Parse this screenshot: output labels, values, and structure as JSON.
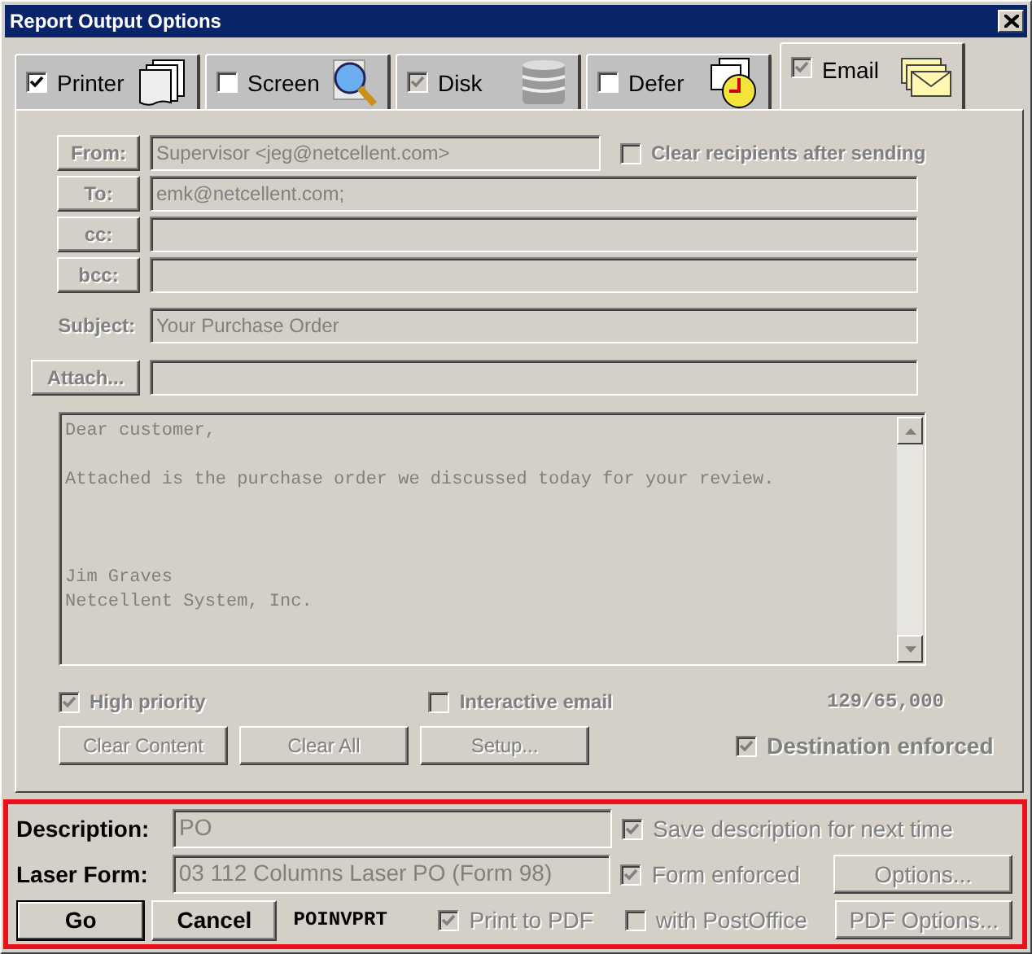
{
  "window": {
    "title": "Report Output Options"
  },
  "tabs": [
    {
      "label": "Printer",
      "kind": "printer",
      "checked": true,
      "disabled": false,
      "selected": false
    },
    {
      "label": "Screen",
      "kind": "screen",
      "checked": false,
      "disabled": false,
      "selected": false
    },
    {
      "label": "Disk",
      "kind": "disk",
      "checked": true,
      "disabled": true,
      "selected": false
    },
    {
      "label": "Defer",
      "kind": "defer",
      "checked": false,
      "disabled": false,
      "selected": false
    },
    {
      "label": "Email",
      "kind": "email",
      "checked": true,
      "disabled": true,
      "selected": true
    }
  ],
  "email": {
    "disabled": true,
    "recipients": [
      {
        "button": "From:",
        "value": "Supervisor <jeg@netcellent.com>"
      },
      {
        "button": "To:",
        "value": "emk@netcellent.com;"
      },
      {
        "button": "cc:"
      },
      {
        "button": "bcc:"
      }
    ],
    "clear_recipients": {
      "label": "Clear recipients after sending",
      "checked": false
    },
    "subject": {
      "label": "Subject:",
      "value": "Your Purchase Order"
    },
    "attach": {
      "button": "Attach..."
    },
    "message": "Dear customer,\n\nAttached is the purchase order we discussed today for your review.\n\n\n\nJim Graves\nNetcellent System, Inc.",
    "options": [
      {
        "label": "High priority",
        "checked": true
      },
      {
        "label": "Interactive email",
        "checked": false
      }
    ],
    "counter": "129/65,000",
    "buttons": [
      "Clear Content",
      "Clear All",
      "Setup..."
    ],
    "destination_enforced": {
      "label": "Destination enforced",
      "checked": true
    }
  },
  "footer": {
    "description": {
      "label": "Description:",
      "value": "PO"
    },
    "save_description": {
      "label": "Save description for next time",
      "checked": true,
      "disabled": true
    },
    "laser_form": {
      "label": "Laser Form:",
      "value": "03 112 Columns Laser PO (Form 98)"
    },
    "form_enforced": {
      "label": "Form enforced",
      "checked": true,
      "disabled": true
    },
    "options_button": {
      "label": "Options...",
      "disabled": true
    },
    "go": "Go",
    "cancel": "Cancel",
    "program": "POINVPRT",
    "print_to_pdf": {
      "label": "Print to PDF",
      "checked": true,
      "disabled": true
    },
    "with_postoffice": {
      "label": "with PostOffice",
      "checked": false,
      "disabled": true
    },
    "pdf_options": {
      "label": "PDF Options...",
      "disabled": true
    }
  }
}
